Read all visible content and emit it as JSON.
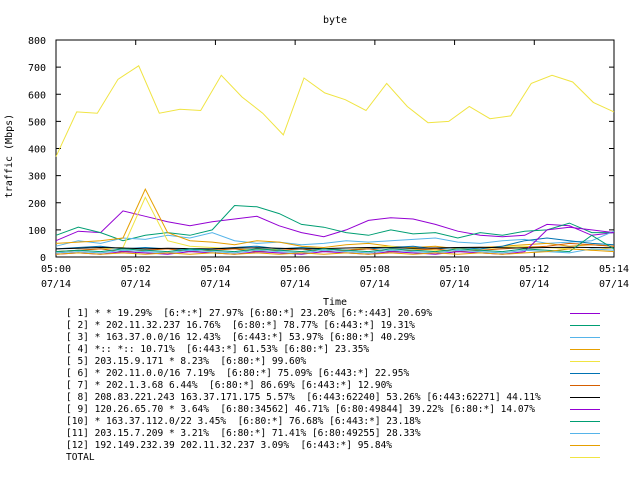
{
  "chart_data": {
    "type": "line",
    "title": "byte",
    "xlabel": "Time",
    "ylabel": "traffic (Mbps)",
    "ylim": [
      0,
      800
    ],
    "yticks": [
      0,
      100,
      200,
      300,
      400,
      500,
      600,
      700,
      800
    ],
    "xlim": [
      0,
      14
    ],
    "xticks": [
      {
        "t": 0,
        "time": "05:00",
        "date": "07/14"
      },
      {
        "t": 2,
        "time": "05:02",
        "date": "07/14"
      },
      {
        "t": 4,
        "time": "05:04",
        "date": "07/14"
      },
      {
        "t": 6,
        "time": "05:06",
        "date": "07/14"
      },
      {
        "t": 8,
        "time": "05:08",
        "date": "07/14"
      },
      {
        "t": 10,
        "time": "05:10",
        "date": "07/14"
      },
      {
        "t": 12,
        "time": "05:12",
        "date": "07/14"
      },
      {
        "t": 14,
        "time": "05:14",
        "date": "07/14"
      }
    ],
    "grid": false,
    "legend_position": "bottom",
    "series": [
      {
        "name": "[ 1] * * 19.29%  [6:*:*] 27.97% [6:80:*] 23.20% [6:*:443] 20.69%",
        "color": "#9400d3",
        "values": [
          60,
          95,
          90,
          170,
          150,
          130,
          115,
          130,
          140,
          150,
          115,
          90,
          75,
          100,
          135,
          145,
          140,
          120,
          95,
          80,
          75,
          80,
          120,
          115,
          80,
          90
        ]
      },
      {
        "name": "[ 2] * 202.11.32.237 16.76%  [6:80:*] 78.77% [6:443:*] 19.31%",
        "color": "#009e73",
        "values": [
          80,
          110,
          90,
          60,
          80,
          90,
          80,
          100,
          190,
          185,
          160,
          120,
          110,
          90,
          80,
          100,
          85,
          90,
          70,
          90,
          80,
          95,
          100,
          125,
          90,
          90
        ]
      },
      {
        "name": "[ 3] * 163.37.0.0/16 12.43%  [6:443:*] 53.97% [6:80:*] 40.29%",
        "color": "#56b4e9",
        "values": [
          40,
          60,
          50,
          70,
          65,
          80,
          70,
          90,
          60,
          50,
          55,
          45,
          50,
          60,
          55,
          60,
          65,
          70,
          55,
          50,
          60,
          65,
          50,
          55,
          60,
          95
        ]
      },
      {
        "name": "[ 4] *:: *:: 10.71%  [6:443:*] 61.53% [6:80:*] 23.35%",
        "color": "#e69f00",
        "values": [
          50,
          55,
          60,
          70,
          250,
          90,
          60,
          55,
          45,
          60,
          55,
          40,
          35,
          45,
          50,
          40,
          35,
          40,
          30,
          35,
          40,
          45,
          50,
          40,
          45,
          40
        ]
      },
      {
        "name": "[ 5] 203.15.9.171 * 8.23%  [6:80:*] 99.60%",
        "color": "#f0e442",
        "values": [
          20,
          25,
          30,
          35,
          220,
          60,
          40,
          35,
          30,
          25,
          30,
          35,
          30,
          25,
          35,
          40,
          30,
          25,
          20,
          30,
          35,
          40,
          35,
          30,
          25,
          35
        ]
      },
      {
        "name": "[ 6] * 202.11.0.0/16 7.19%  [6:80:*] 75.09% [6:443:*] 22.95%",
        "color": "#0072b2",
        "values": [
          30,
          35,
          40,
          30,
          35,
          30,
          25,
          30,
          35,
          40,
          30,
          35,
          30,
          25,
          30,
          35,
          40,
          30,
          35,
          30,
          40,
          60,
          70,
          60,
          50,
          45
        ]
      },
      {
        "name": "[ 7] * 202.1.3.68 6.44%  [6:80:*] 86.69% [6:443:*] 12.90%",
        "color": "#d55e00",
        "values": [
          20,
          25,
          30,
          20,
          25,
          30,
          20,
          25,
          30,
          20,
          25,
          30,
          20,
          25,
          30,
          20,
          25,
          30,
          20,
          25,
          30,
          35,
          40,
          50,
          45,
          40
        ]
      },
      {
        "name": "[ 8] 208.83.221.243 163.37.171.175 5.57%  [6:443:62240] 53.26% [6:443:62271] 44.11%",
        "color": "#000000",
        "values": [
          30,
          32,
          35,
          33,
          30,
          32,
          31,
          30,
          33,
          34,
          32,
          30,
          31,
          33,
          35,
          34,
          32,
          33,
          35,
          36,
          34,
          33,
          35,
          36,
          35,
          34
        ]
      },
      {
        "name": "[ 9] 120.26.65.70 * 3.64%  [6:80:34562] 46.71% [6:80:49844] 39.22% [6:80:*] 14.07%",
        "color": "#9400d3",
        "values": [
          10,
          15,
          10,
          20,
          15,
          10,
          20,
          15,
          10,
          20,
          15,
          10,
          20,
          15,
          10,
          20,
          15,
          10,
          20,
          15,
          10,
          20,
          100,
          110,
          100,
          90
        ]
      },
      {
        "name": "[10] * 163.37.112.0/22 3.45%  [6:80:*] 76.68% [6:443:*] 23.18%",
        "color": "#009e73",
        "values": [
          20,
          25,
          20,
          30,
          25,
          20,
          30,
          25,
          20,
          30,
          25,
          20,
          30,
          25,
          20,
          30,
          25,
          20,
          30,
          25,
          20,
          30,
          25,
          20,
          80,
          30
        ]
      },
      {
        "name": "[11] 203.15.7.209 * 3.21%  [6:80:*] 71.41% [6:80:49255] 28.33%",
        "color": "#56b4e9",
        "values": [
          15,
          20,
          15,
          25,
          20,
          15,
          25,
          20,
          15,
          25,
          20,
          15,
          25,
          20,
          15,
          25,
          20,
          15,
          25,
          20,
          15,
          25,
          20,
          15,
          30,
          25
        ]
      },
      {
        "name": "[12] 192.149.232.39 202.11.32.237 3.09%  [6:443:*] 95.84%",
        "color": "#e69f00",
        "values": [
          10,
          15,
          10,
          15,
          10,
          15,
          10,
          15,
          10,
          15,
          10,
          15,
          10,
          15,
          10,
          15,
          10,
          15,
          10,
          15,
          10,
          15,
          20,
          30,
          25,
          20
        ]
      },
      {
        "name": "TOTAL",
        "color": "#f0e442",
        "values": [
          370,
          535,
          530,
          655,
          705,
          530,
          545,
          540,
          670,
          590,
          530,
          450,
          660,
          605,
          580,
          540,
          640,
          555,
          495,
          500,
          555,
          510,
          520,
          640,
          670,
          645,
          570,
          535
        ]
      }
    ]
  }
}
